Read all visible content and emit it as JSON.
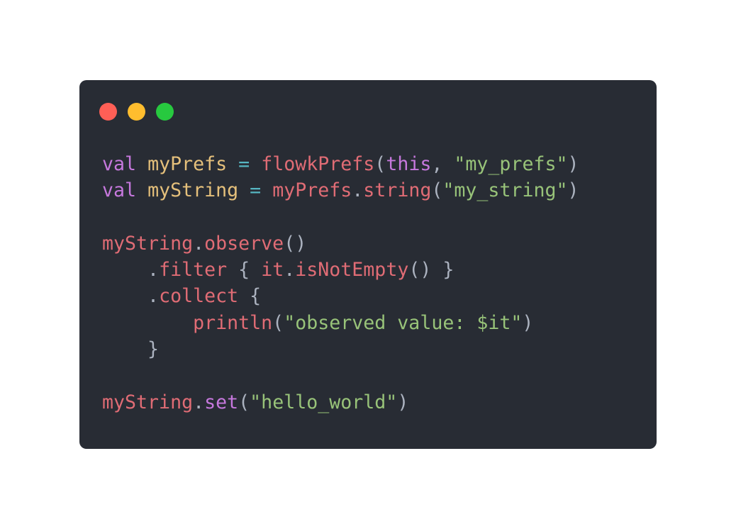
{
  "window": {
    "controls": [
      {
        "name": "close-button",
        "color": "#ff5f56"
      },
      {
        "name": "minimize-button",
        "color": "#ffbd2e"
      },
      {
        "name": "maximize-button",
        "color": "#27c93f"
      }
    ]
  },
  "code": {
    "lines": [
      [
        {
          "text": "val",
          "type": "kw"
        },
        {
          "text": " ",
          "type": "plain"
        },
        {
          "text": "myPrefs",
          "type": "var"
        },
        {
          "text": " ",
          "type": "plain"
        },
        {
          "text": "=",
          "type": "op"
        },
        {
          "text": " ",
          "type": "plain"
        },
        {
          "text": "flowkPrefs",
          "type": "fn"
        },
        {
          "text": "(",
          "type": "plain"
        },
        {
          "text": "this",
          "type": "kw"
        },
        {
          "text": ", ",
          "type": "plain"
        },
        {
          "text": "\"my_prefs\"",
          "type": "str"
        },
        {
          "text": ")",
          "type": "plain"
        }
      ],
      [
        {
          "text": "val",
          "type": "kw"
        },
        {
          "text": " ",
          "type": "plain"
        },
        {
          "text": "myString",
          "type": "var"
        },
        {
          "text": " ",
          "type": "plain"
        },
        {
          "text": "=",
          "type": "op"
        },
        {
          "text": " ",
          "type": "plain"
        },
        {
          "text": "myPrefs",
          "type": "fn"
        },
        {
          "text": ".",
          "type": "plain"
        },
        {
          "text": "string",
          "type": "fn"
        },
        {
          "text": "(",
          "type": "plain"
        },
        {
          "text": "\"my_string\"",
          "type": "str"
        },
        {
          "text": ")",
          "type": "plain"
        }
      ],
      [],
      [
        {
          "text": "myString",
          "type": "fn"
        },
        {
          "text": ".",
          "type": "plain"
        },
        {
          "text": "observe",
          "type": "fn"
        },
        {
          "text": "()",
          "type": "plain"
        }
      ],
      [
        {
          "text": "    .",
          "type": "plain"
        },
        {
          "text": "filter",
          "type": "fn"
        },
        {
          "text": " { ",
          "type": "plain"
        },
        {
          "text": "it",
          "type": "fn"
        },
        {
          "text": ".",
          "type": "plain"
        },
        {
          "text": "isNotEmpty",
          "type": "fn"
        },
        {
          "text": "() }",
          "type": "plain"
        }
      ],
      [
        {
          "text": "    .",
          "type": "plain"
        },
        {
          "text": "collect",
          "type": "fn"
        },
        {
          "text": " {",
          "type": "plain"
        }
      ],
      [
        {
          "text": "        ",
          "type": "plain"
        },
        {
          "text": "println",
          "type": "fn"
        },
        {
          "text": "(",
          "type": "plain"
        },
        {
          "text": "\"observed value: $it\"",
          "type": "str"
        },
        {
          "text": ")",
          "type": "plain"
        }
      ],
      [
        {
          "text": "    }",
          "type": "plain"
        }
      ],
      [],
      [
        {
          "text": "myString",
          "type": "fn"
        },
        {
          "text": ".",
          "type": "plain"
        },
        {
          "text": "set",
          "type": "kw"
        },
        {
          "text": "(",
          "type": "plain"
        },
        {
          "text": "\"hello_world\"",
          "type": "str"
        },
        {
          "text": ")",
          "type": "plain"
        }
      ]
    ]
  }
}
